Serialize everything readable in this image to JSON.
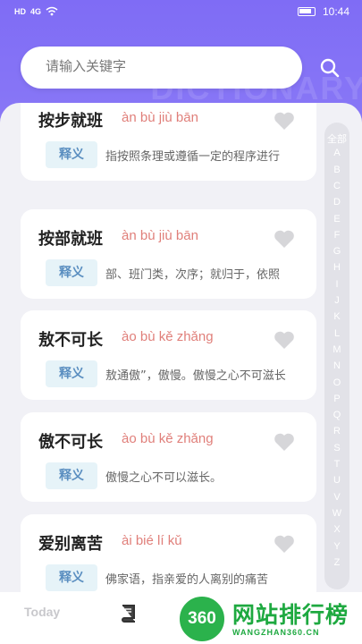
{
  "statusbar": {
    "left_icons": [
      "HD",
      "4G"
    ],
    "time": "10:44"
  },
  "watermark": "DICTIONARY",
  "search": {
    "placeholder": "请输入关键字",
    "value": ""
  },
  "tag_label": "释义",
  "entries": [
    {
      "word": "按步就班",
      "pinyin": "àn bù jiù bān",
      "meaning": "指按照条理或遵循一定的程序进行"
    },
    {
      "word": "按部就班",
      "pinyin": "àn bù jiù bān",
      "meaning": "部、班门类，次序；就归于，依照"
    },
    {
      "word": "敖不可长",
      "pinyin": "ào bù kě zhǎng",
      "meaning": "敖通傲”，傲慢。傲慢之心不可滋长"
    },
    {
      "word": "傲不可长",
      "pinyin": "ào bù kě zhǎng",
      "meaning": "傲慢之心不可以滋长。"
    },
    {
      "word": "爱别离苦",
      "pinyin": "ài bié lí kǔ",
      "meaning": "佛家语，指亲爱的人离别的痛苦"
    }
  ],
  "alphabet": [
    "全部",
    "A",
    "B",
    "C",
    "D",
    "E",
    "F",
    "G",
    "H",
    "I",
    "J",
    "K",
    "L",
    "M",
    "N",
    "O",
    "P",
    "Q",
    "R",
    "S",
    "T",
    "U",
    "V",
    "W",
    "X",
    "Y",
    "Z"
  ],
  "nav": {
    "today": "Today"
  },
  "site_badge": {
    "logo_text": "360",
    "title": "网站排行榜",
    "url": "WANGZHAN360.CN"
  },
  "colors": {
    "header": "#7f6cf5",
    "pinyin": "#e07f7a",
    "tag_bg": "#e6f3f8",
    "tag_text": "#5a8ec0",
    "badge_green": "#1ea940"
  }
}
